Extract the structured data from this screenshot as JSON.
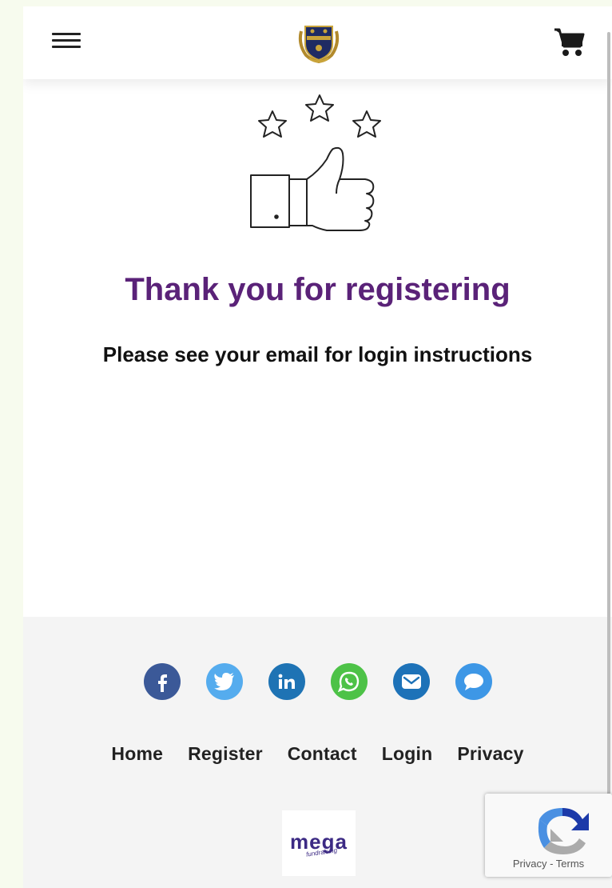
{
  "header": {
    "menu_icon": "hamburger-icon",
    "logo_icon": "school-crest-icon",
    "cart_icon": "shopping-cart-icon"
  },
  "main": {
    "hero_icon": "thumbs-up-stars-icon",
    "title": "Thank you for registering",
    "subtitle": "Please see your email for login instructions",
    "title_color": "#5a2278"
  },
  "footer": {
    "social": [
      {
        "name": "facebook-icon",
        "color": "#3b5998"
      },
      {
        "name": "twitter-icon",
        "color": "#55acee"
      },
      {
        "name": "linkedin-icon",
        "color": "#1e73b4"
      },
      {
        "name": "whatsapp-icon",
        "color": "#4dc247"
      },
      {
        "name": "email-icon",
        "color": "#1d72b8"
      },
      {
        "name": "chat-icon",
        "color": "#3d97e6"
      }
    ],
    "nav": {
      "home": "Home",
      "register": "Register",
      "contact": "Contact",
      "login": "Login",
      "privacy": "Privacy"
    },
    "brand": {
      "name": "mega",
      "tagline": "fundraising"
    }
  },
  "recaptcha": {
    "privacy": "Privacy",
    "separator": " - ",
    "terms": "Terms"
  }
}
